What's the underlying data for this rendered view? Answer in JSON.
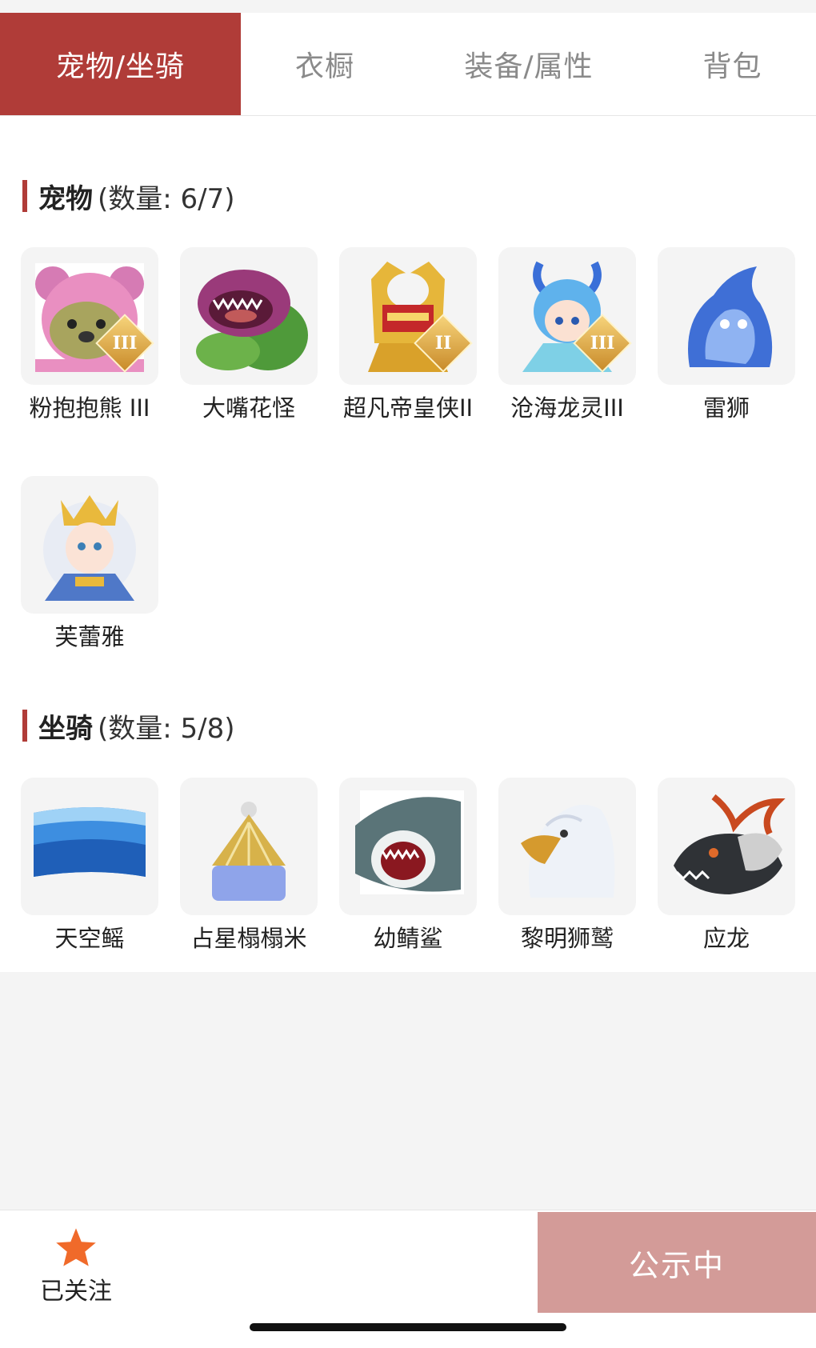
{
  "tabs": [
    {
      "label": "宠物/坐骑",
      "active": true
    },
    {
      "label": "衣橱",
      "active": false
    },
    {
      "label": "装备/属性",
      "active": false
    },
    {
      "label": "背包",
      "active": false
    }
  ],
  "pets": {
    "title": "宠物",
    "count_text": "(数量: 6/7)",
    "items": [
      {
        "name": "粉抱抱熊 III",
        "badge": "III"
      },
      {
        "name": "大嘴花怪",
        "badge": ""
      },
      {
        "name": "超凡帝皇侠II",
        "badge": "II"
      },
      {
        "name": "沧海龙灵III",
        "badge": "III"
      },
      {
        "name": "雷狮",
        "badge": ""
      },
      {
        "name": "芙蕾雅",
        "badge": ""
      }
    ]
  },
  "mounts": {
    "title": "坐骑",
    "count_text": "(数量: 5/8)",
    "items": [
      {
        "name": "天空鳐"
      },
      {
        "name": "占星榻榻米"
      },
      {
        "name": "幼鲭鲨"
      },
      {
        "name": "黎明狮鹫"
      },
      {
        "name": "应龙"
      }
    ]
  },
  "footer": {
    "follow_label": "已关注",
    "action_label": "公示中"
  },
  "colors": {
    "accent": "#b03c38",
    "action_button": "#d39b98",
    "star": "#f06a2a"
  }
}
